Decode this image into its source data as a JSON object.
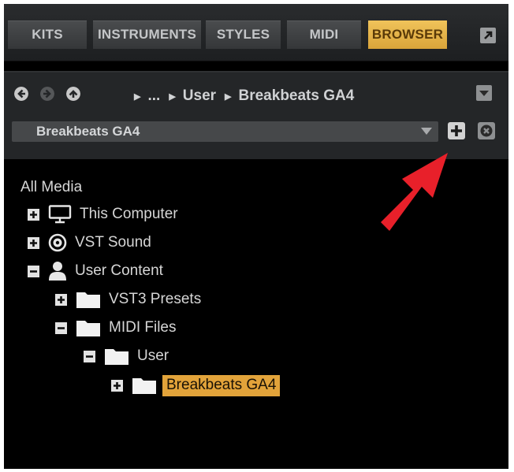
{
  "tabs": [
    {
      "label": "KITS",
      "active": false
    },
    {
      "label": "INSTRUMENTS",
      "active": false
    },
    {
      "label": "STYLES",
      "active": false
    },
    {
      "label": "MIDI",
      "active": false
    },
    {
      "label": "BROWSER",
      "active": true
    }
  ],
  "breadcrumb": {
    "ellipsis": "...",
    "items": [
      "User",
      "Breakbeats GA4"
    ]
  },
  "path_select": {
    "value": "Breakbeats GA4"
  },
  "tree": {
    "root_label": "All Media",
    "items": [
      {
        "label": "This Computer",
        "icon": "monitor-icon",
        "expanded": false,
        "selected": false
      },
      {
        "label": "VST Sound",
        "icon": "disc-icon",
        "expanded": false,
        "selected": false
      },
      {
        "label": "User Content",
        "icon": "user-icon",
        "expanded": true,
        "selected": false
      },
      {
        "label": "VST3 Presets",
        "icon": "folder-icon",
        "expanded": false,
        "selected": false
      },
      {
        "label": "MIDI Files",
        "icon": "folder-icon",
        "expanded": true,
        "selected": false
      },
      {
        "label": "User",
        "icon": "folder-icon",
        "expanded": true,
        "selected": false
      },
      {
        "label": "Breakbeats GA4",
        "icon": "folder-icon",
        "expanded": false,
        "selected": true
      }
    ]
  },
  "colors": {
    "accent": "#e2a33a",
    "background": "#000000",
    "panel": "#242628",
    "annotation_arrow": "#e8202a"
  }
}
